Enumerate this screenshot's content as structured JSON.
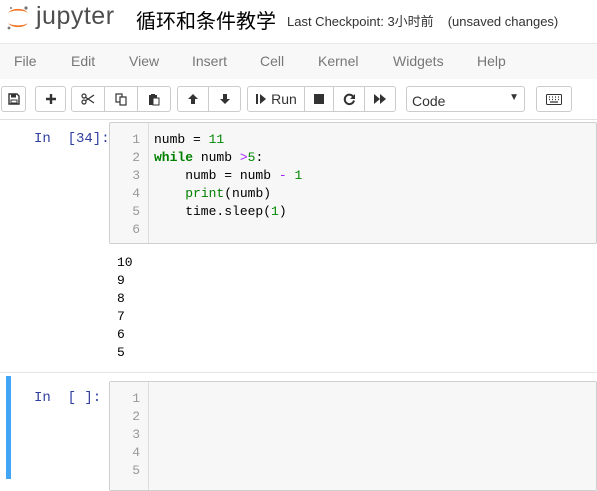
{
  "header": {
    "logo_text": "jupyter",
    "notebook_title": "循环和条件教学",
    "checkpoint": "Last Checkpoint: 3小时前",
    "unsaved": "(unsaved changes)"
  },
  "menu": [
    "File",
    "Edit",
    "View",
    "Insert",
    "Cell",
    "Kernel",
    "Widgets",
    "Help"
  ],
  "toolbar": {
    "run_label": "Run",
    "cell_type": "Code",
    "icons": [
      "save-icon",
      "plus-icon",
      "cut-icon",
      "copy-icon",
      "paste-icon",
      "arrow-up-icon",
      "arrow-down-icon",
      "run-icon",
      "stop-icon",
      "restart-icon",
      "fast-forward-icon",
      "keyboard-icon"
    ]
  },
  "cells": [
    {
      "prompt": "In  [34]:",
      "line_numbers": [
        "1",
        "2",
        "3",
        "4",
        "5",
        "6"
      ],
      "code": [
        "numb = 11",
        "while numb >5:",
        "    numb = numb - 1",
        "    print(numb)",
        "    time.sleep(1)",
        ""
      ],
      "outputs": [
        "10",
        "9",
        "8",
        "7",
        "6",
        "5"
      ]
    },
    {
      "prompt": "In  [ ]:",
      "line_numbers": [
        "1",
        "2",
        "3",
        "4",
        "5"
      ],
      "code": [
        "",
        "",
        "",
        "",
        ""
      ]
    }
  ],
  "colors": {
    "prompt": "#303f9f",
    "selected_bar": "#42a5f5",
    "keyword": "#008000",
    "operator": "#aa22ff",
    "logo_orange": "#f37726"
  }
}
